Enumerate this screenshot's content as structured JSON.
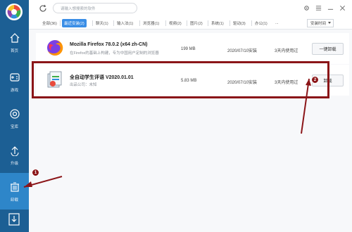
{
  "colors": {
    "sidebar_bg": "#1c5f94",
    "active_nav": "#2e86c9",
    "accent": "#3a8ee6",
    "annotation": "#8b1518"
  },
  "search": {
    "placeholder": "请输入想搜索的软件"
  },
  "sidebar": {
    "items": [
      {
        "label": "首页",
        "icon": "home-icon"
      },
      {
        "label": "游戏",
        "icon": "gamepad-icon"
      },
      {
        "label": "宝库",
        "icon": "treasure-icon"
      },
      {
        "label": "升级",
        "icon": "upgrade-icon"
      },
      {
        "label": "卸载",
        "icon": "trash-icon",
        "active": true
      }
    ],
    "bottom_icon": "download-icon"
  },
  "tabs": [
    {
      "label": "全部(36)"
    },
    {
      "label": "最近安装(2)",
      "active": true
    },
    {
      "label": "聊天(1)"
    },
    {
      "label": "输入法(1)"
    },
    {
      "label": "浏览器(1)"
    },
    {
      "label": "视频(2)"
    },
    {
      "label": "图片(2)"
    },
    {
      "label": "系统(1)"
    },
    {
      "label": "驱动(3)"
    },
    {
      "label": "办公(1)"
    }
  ],
  "tabs_more": "...",
  "sort": {
    "selected": "安装时间"
  },
  "apps": [
    {
      "name": "Mozilla Firefox 78.0.2 (x64 zh-CN)",
      "description": "在Firefox的基础上构建，专为中国用户定制的浏览器",
      "size": "199 MB",
      "date": "2020/07/10安装",
      "usage": "3天内使用过",
      "button": "一键卸载",
      "icon": "firefox-icon"
    },
    {
      "name": "全自动学生评语 V2020.01.01",
      "description": "出品公司：未知",
      "size": "5.83 MB",
      "date": "2020/07/10安装",
      "usage": "3天内使用过",
      "button": "卸载",
      "icon": "installer-icon"
    }
  ],
  "annotations": {
    "badge1": "1",
    "badge2": "2"
  }
}
